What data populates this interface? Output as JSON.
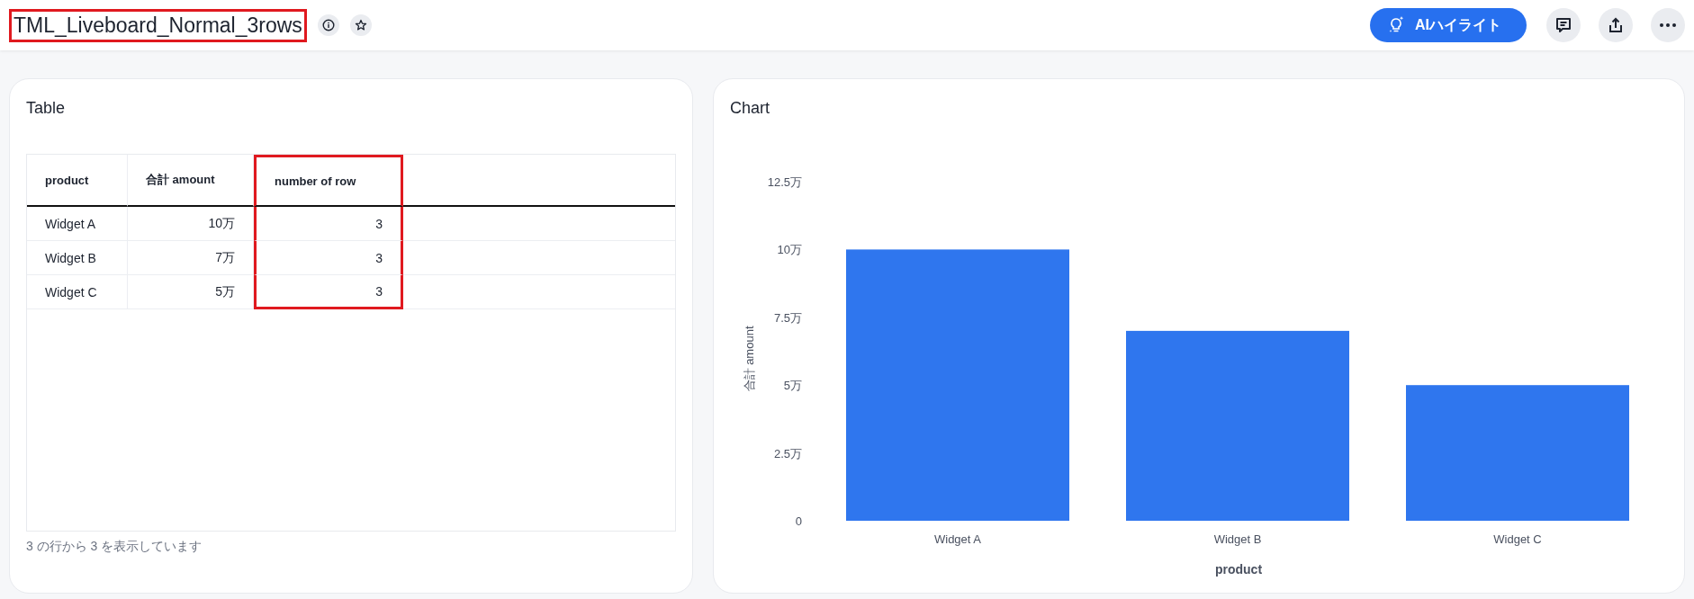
{
  "header": {
    "title": "TML_Liveboard_Normal_3rows",
    "title_highlighted": true,
    "ai_button": "AIハイライト"
  },
  "table_card": {
    "title": "Table",
    "columns": [
      {
        "label": "product",
        "highlighted": false
      },
      {
        "label": "合計 amount",
        "highlighted": false
      },
      {
        "label": "number of row",
        "highlighted": true
      }
    ],
    "rows": [
      [
        "Widget A",
        "10万",
        "3"
      ],
      [
        "Widget B",
        "7万",
        "3"
      ],
      [
        "Widget C",
        "5万",
        "3"
      ]
    ],
    "footer": "3 の行から 3 を表示しています"
  },
  "chart_card": {
    "title": "Chart",
    "chart_data": {
      "type": "bar",
      "xlabel": "product",
      "ylabel": "合計 amount",
      "categories": [
        "Widget A",
        "Widget B",
        "Widget C"
      ],
      "series": [
        {
          "color": "#2f76ee",
          "values": [
            10,
            7,
            5
          ]
        }
      ],
      "ylim": [
        0,
        12.5
      ],
      "yticks": [
        {
          "value": 0,
          "label": "0"
        },
        {
          "value": 2.5,
          "label": "2.5万"
        },
        {
          "value": 5,
          "label": "5万"
        },
        {
          "value": 7.5,
          "label": "7.5万"
        },
        {
          "value": 10,
          "label": "10万"
        },
        {
          "value": 12.5,
          "label": "12.5万"
        }
      ]
    }
  }
}
